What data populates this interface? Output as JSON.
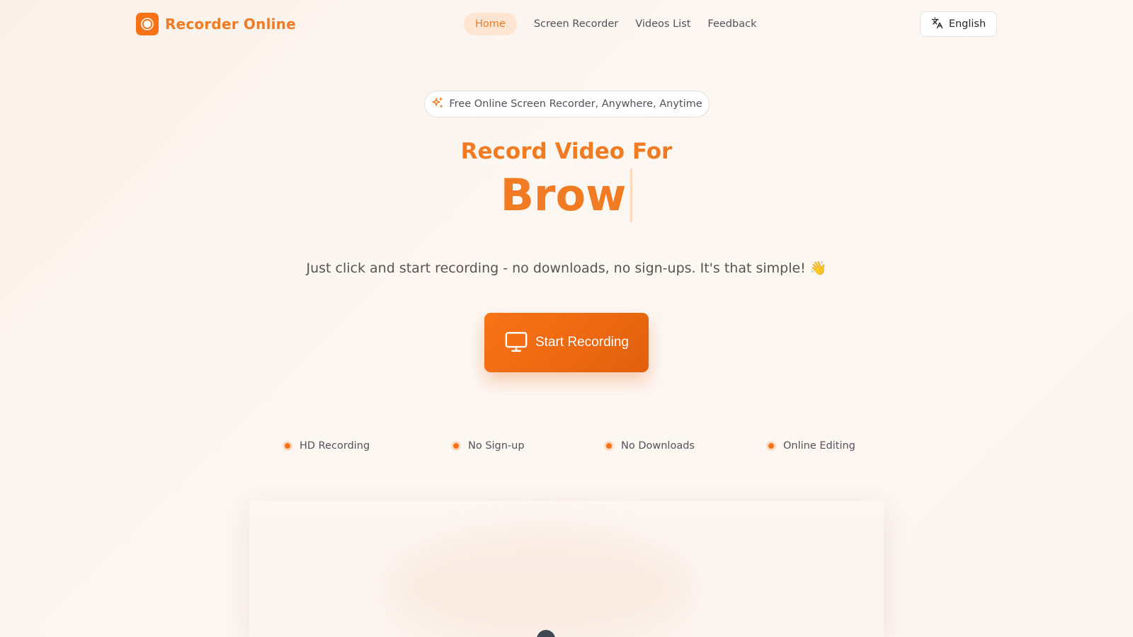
{
  "header": {
    "logo_text": "Recorder Online",
    "nav": [
      {
        "label": "Home",
        "active": true
      },
      {
        "label": "Screen Recorder",
        "active": false
      },
      {
        "label": "Videos List",
        "active": false
      },
      {
        "label": "Feedback",
        "active": false
      }
    ],
    "language": "English"
  },
  "hero": {
    "badge": "Free Online Screen Recorder, Anywhere, Anytime",
    "headline": "Record Video For",
    "typed_word": "Brow",
    "subtitle": "Just click and start recording - no downloads, no sign-ups. It's that simple! 👋",
    "cta_label": "Start Recording"
  },
  "features": [
    "HD Recording",
    "No Sign-up",
    "No Downloads",
    "Online Editing"
  ],
  "colors": {
    "accent": "#f97316",
    "accent_dark": "#e2600d",
    "accent_soft": "#fde5d2",
    "text": "#52525b"
  },
  "icons": {
    "logo": "record-icon",
    "language": "translate-icon",
    "badge": "sparkles-icon",
    "cta": "monitor-icon"
  }
}
